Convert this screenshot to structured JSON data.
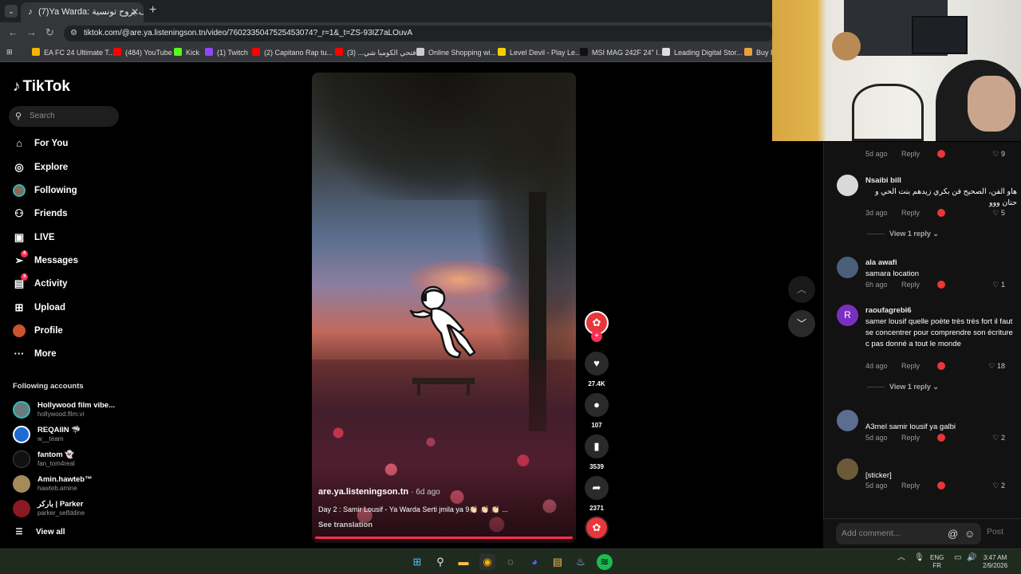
{
  "browser": {
    "tab_title": "(7)Ya Warda: صيف بروح تونسية",
    "new_tab": "+",
    "url": "tiktok.com/@are.ya.listeningson.tn/video/7602335047525453074?_r=1&_t=ZS-93IZ7aLOuvA",
    "bookmarks": [
      {
        "label": "EA FC 24 Ultimate T...",
        "color": "#f4b400"
      },
      {
        "label": "(484) YouTube",
        "color": "#ff0000"
      },
      {
        "label": "Kick",
        "color": "#53fc18"
      },
      {
        "label": "(1) Twitch",
        "color": "#9146ff"
      },
      {
        "label": "(2) Capitano Rap tu...",
        "color": "#ff0000"
      },
      {
        "label": "فتحي الكوميا شي... (3)",
        "color": "#ff0000"
      },
      {
        "label": "Online Shopping wi...",
        "color": "#cccccc"
      },
      {
        "label": "Level Devil - Play Le...",
        "color": "#f4d000"
      },
      {
        "label": "MSI MAG 242F 24\" I...",
        "color": "#111111"
      },
      {
        "label": "Leading Digital Stor...",
        "color": "#dddddd"
      },
      {
        "label": "Buy P",
        "color": "#e6a23c"
      }
    ]
  },
  "tiktok": {
    "logo": "TikTok",
    "search_placeholder": "Search",
    "nav": [
      {
        "label": "For You",
        "icon": "home-icon",
        "glyph": "⌂"
      },
      {
        "label": "Explore",
        "icon": "compass-icon",
        "glyph": "◎"
      },
      {
        "label": "Following",
        "icon": "avatar-icon",
        "glyph": "●"
      },
      {
        "label": "Friends",
        "icon": "friends-icon",
        "glyph": "👥"
      },
      {
        "label": "LIVE",
        "icon": "live-icon",
        "glyph": "▣"
      },
      {
        "label": "Messages",
        "icon": "messages-icon",
        "glyph": "➤",
        "badge": "4"
      },
      {
        "label": "Activity",
        "icon": "activity-icon",
        "glyph": "▤",
        "badge": "3"
      },
      {
        "label": "Upload",
        "icon": "upload-icon",
        "glyph": "⊞"
      },
      {
        "label": "Profile",
        "icon": "profile-icon",
        "glyph": "●"
      },
      {
        "label": "More",
        "icon": "more-icon",
        "glyph": "···"
      }
    ],
    "following_title": "Following accounts",
    "following": [
      {
        "name": "Hollywood film vibe...",
        "handle": "hollywood.fllm.vi",
        "color": "#6b7a80"
      },
      {
        "name": "REQAIIN 🦈",
        "handle": "w__team",
        "color": "#1e6bd6"
      },
      {
        "name": "fantom 👻",
        "handle": "fan_tom4real",
        "color": "#111111"
      },
      {
        "name": "Amin.hawteb™",
        "handle": "hawteb.amine",
        "color": "#a58a5a"
      },
      {
        "name": "باركر | Parker",
        "handle": "parker_selfddine",
        "color": "#8a1a22"
      }
    ],
    "view_all": "View all"
  },
  "video": {
    "author": "are.ya.listeningson.tn",
    "age": "· 6d ago",
    "caption": "Day 2 : Samir Lousif - Ya Warda Serti jmila ya 9👏🏻 👏🏻 👏🏻 ...",
    "see_translation": "See translation",
    "likes": "27.4K",
    "comments": "107",
    "saves": "3539",
    "shares": "2371"
  },
  "comments": {
    "top_meta": {
      "age": "5d ago",
      "reply": "Reply",
      "likes": "9"
    },
    "items": [
      {
        "user": "Nsaibi bill",
        "text": "هاو الفن، الصحيح فن بكري زيدهم بنت الحي و حنان ووو",
        "age": "3d ago",
        "reply": "Reply",
        "likes": "5",
        "avatar": "#d9d9d9",
        "initial": "",
        "view_replies": "View 1 reply"
      },
      {
        "user": "ala awafi",
        "text": "samara location",
        "age": "6h ago",
        "reply": "Reply",
        "likes": "1",
        "avatar": "#4b5e7a",
        "initial": ""
      },
      {
        "user": "raoufagrebi6",
        "text": "samer lousif quelle poète très très fort il faut se concentrer pour comprendre son écriture c pas donné a tout le monde",
        "age": "4d ago",
        "reply": "Reply",
        "likes": "18",
        "avatar": "#7b2fbf",
        "initial": "R",
        "view_replies": "View 1 reply"
      },
      {
        "user": "",
        "text": "A3mel samir lousif ya galbi",
        "age": "5d ago",
        "reply": "Reply",
        "likes": "2",
        "avatar": "#5a6e8e",
        "initial": ""
      },
      {
        "user": "",
        "text": "[sticker]",
        "age": "5d ago",
        "reply": "Reply",
        "likes": "2",
        "avatar": "#6b5a3a",
        "initial": ""
      }
    ],
    "add_placeholder": "Add comment...",
    "post": "Post"
  },
  "taskbar": {
    "lang": "ENG",
    "layout": "FR",
    "time": "3:47 AM",
    "date": "2/9/2026"
  }
}
